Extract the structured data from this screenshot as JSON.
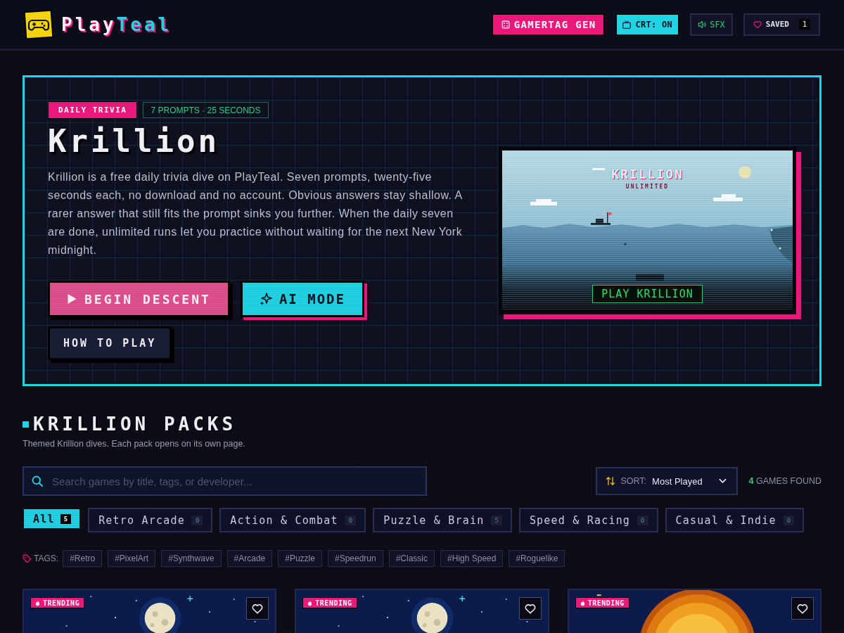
{
  "header": {
    "logo": {
      "first": "Play",
      "second": "Teal"
    },
    "actions": [
      {
        "kind": "generator",
        "label": "GAMERTAG GEN"
      },
      {
        "kind": "crt",
        "label": "CRT: ON"
      },
      {
        "kind": "sound",
        "label": "SFX"
      },
      {
        "kind": "saved",
        "label": "SAVED",
        "count": "1"
      }
    ]
  },
  "hero": {
    "badge": "DAILY TRIVIA",
    "meta": "7 PROMPTS · 25 SECONDS",
    "title": "Krillion",
    "description": "Krillion is a free daily trivia dive on PlayTeal. Seven prompts, twenty-five seconds each, no download and no account. Obvious answers stay shallow. A rarer answer that still fits the prompt sinks you further. When the daily seven are done, unlimited runs let you practice without waiting for the next New York midnight.",
    "buttons": [
      {
        "kind": "primary",
        "label": "BEGIN DESCENT"
      },
      {
        "kind": "ai",
        "label": "AI MODE"
      },
      {
        "kind": "outline",
        "label": "HOW TO PLAY"
      }
    ],
    "preview": {
      "title": "KRILLION",
      "subtitle": "UNLIMITED",
      "button": "PLAY KRILLION"
    }
  },
  "packs": {
    "title": "KRILLION PACKS",
    "subtitle": "Themed Krillion dives. Each pack opens on its own page.",
    "search": {
      "placeholder": "Search games by title, tags, or developer..."
    },
    "sort": {
      "label": "SORT:",
      "value": "Most Played"
    },
    "results": {
      "count": "4",
      "label": "GAMES FOUND"
    },
    "categories": [
      {
        "label": "All",
        "count": "5",
        "selected": true
      },
      {
        "label": "Retro Arcade",
        "count": "0",
        "selected": false
      },
      {
        "label": "Action & Combat",
        "count": "0",
        "selected": false
      },
      {
        "label": "Puzzle & Brain",
        "count": "5",
        "selected": false
      },
      {
        "label": "Speed & Racing",
        "count": "0",
        "selected": false
      },
      {
        "label": "Casual & Indie",
        "count": "0",
        "selected": false
      }
    ],
    "tags": {
      "label": "TAGS:",
      "items": [
        "#Retro",
        "#PixelArt",
        "#Synthwave",
        "#Arcade",
        "#Puzzle",
        "#Speedrun",
        "#Classic",
        "#High Speed",
        "#Roguelike"
      ]
    },
    "cards": [
      {
        "badge": "TRENDING",
        "kind": "moon"
      },
      {
        "badge": "TRENDING",
        "kind": "moon"
      },
      {
        "badge": "TRENDING",
        "kind": "sun"
      }
    ]
  }
}
